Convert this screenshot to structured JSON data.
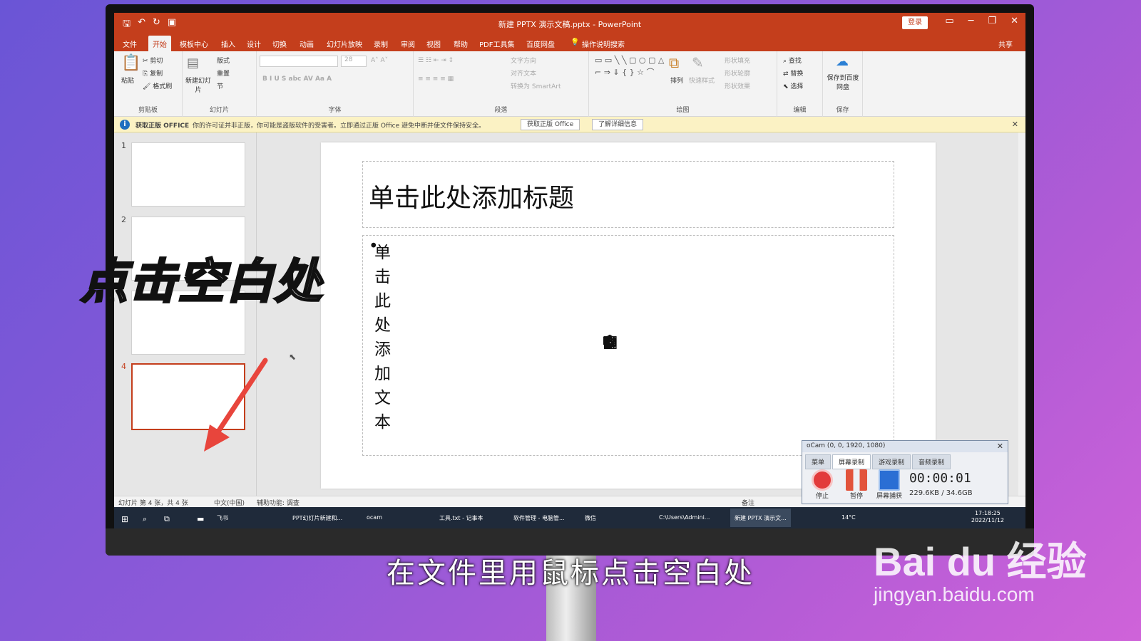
{
  "window": {
    "title": "新建 PPTX 演示文稿.pptx - PowerPoint",
    "login": "登录",
    "share": "共享"
  },
  "menu": [
    "文件",
    "开始",
    "模板中心",
    "插入",
    "设计",
    "切换",
    "动画",
    "幻灯片放映",
    "录制",
    "审阅",
    "视图",
    "帮助",
    "PDF工具集",
    "百度网盘",
    "操作说明搜索"
  ],
  "ribbon": {
    "clipboard": {
      "paste": "粘贴",
      "cut": "剪切",
      "copy": "复制",
      "format_painter": "格式刷",
      "label": "剪贴板"
    },
    "slides": {
      "new_slide": "新建幻灯片",
      "layout": "版式",
      "reset": "重置",
      "section": "节",
      "label": "幻灯片"
    },
    "font": {
      "size": "28",
      "label": "字体"
    },
    "paragraph": {
      "text_dir": "文字方向",
      "align_text": "对齐文本",
      "smartart": "转换为 SmartArt",
      "label": "段落"
    },
    "drawing": {
      "arrange": "排列",
      "quick_styles": "快速样式",
      "fill": "形状填充",
      "outline": "形状轮廓",
      "effects": "形状效果",
      "label": "绘图"
    },
    "editing": {
      "find": "查找",
      "replace": "替换",
      "select": "选择",
      "label": "编辑"
    },
    "save": {
      "save_baidu": "保存到百度网盘",
      "label": "保存"
    }
  },
  "infobar": {
    "title": "获取正版 OFFICE",
    "message": "你的许可证并非正版，你可能是盗版软件的受害者。立即通过正版 Office 避免中断并使文件保持安全。",
    "btn_get": "获取正版 Office",
    "btn_more": "了解详细信息"
  },
  "thumbnails": [
    "1",
    "2",
    "4"
  ],
  "slide": {
    "title_placeholder": "单击此处添加标题",
    "body_placeholder": "单击此处添加文本"
  },
  "statusbar": {
    "slide_info": "幻灯片 第 4 张，共 4 张",
    "language": "中文(中国)",
    "accessibility": "辅助功能: 调查",
    "notes": "备注"
  },
  "taskbar": {
    "items": [
      "飞书",
      "PPT幻灯片新建和...",
      "ocam",
      "工具.txt - 记事本",
      "软件管理 - 电脑管...",
      "微信",
      "C:\\Users\\Admini...",
      "新建 PPTX 演示文..."
    ],
    "temp": "14°C",
    "time": "17:18:25",
    "date": "2022/11/12"
  },
  "ime": {
    "label": "中"
  },
  "ocam": {
    "title": "oCam (0, 0, 1920, 1080)",
    "tabs": [
      "菜单",
      "屏幕录制",
      "游戏录制",
      "音频录制"
    ],
    "stop": "停止",
    "pause": "暂停",
    "capture": "屏幕捕获",
    "timer": "00:00:01",
    "size": "229.6KB / 34.6GB"
  },
  "overlay_caption": "点击空白处",
  "subtitle": "在文件里用鼠标点击空白处",
  "watermark": {
    "brand": "Bai du 经验",
    "url": "jingyan.baidu.com"
  },
  "colors": {
    "accent": "#c43e1c",
    "selection": "#c43e1c",
    "arrow": "#e8453c"
  }
}
